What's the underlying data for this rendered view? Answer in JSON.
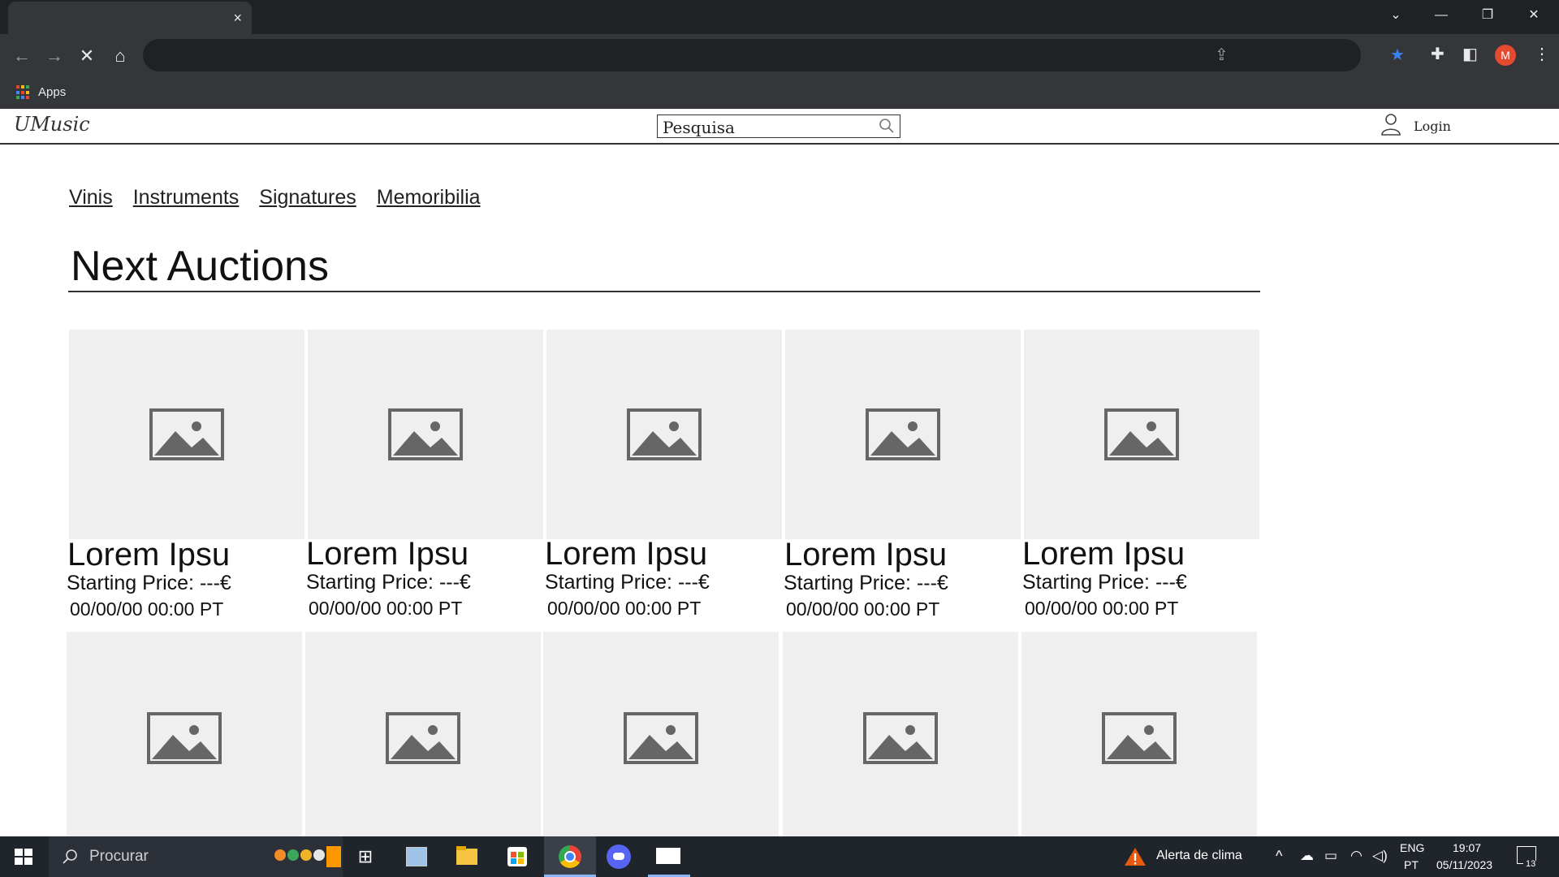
{
  "browser": {
    "tab_close": "×",
    "bookmarks": {
      "apps_label": "Apps"
    },
    "avatar_letter": "M"
  },
  "site": {
    "logo": "UMusic",
    "search_placeholder": "Pesquisa",
    "login_label": "Login",
    "categories": [
      "Vinis",
      "Instruments",
      "Signatures",
      "Memoribilia"
    ],
    "heading": "Next Auctions",
    "cards": [
      {
        "title": "Lorem Ipsu",
        "price": "Starting Price: ---€",
        "date": "00/00/00 00:00 PT"
      },
      {
        "title": "Lorem Ipsu",
        "price": "Starting Price: ---€",
        "date": "00/00/00 00:00 PT"
      },
      {
        "title": "Lorem Ipsu",
        "price": "Starting Price: ---€",
        "date": "00/00/00 00:00 PT"
      },
      {
        "title": "Lorem Ipsu",
        "price": "Starting Price: ---€",
        "date": "00/00/00 00:00 PT"
      },
      {
        "title": "Lorem Ipsu",
        "price": "Starting Price: ---€",
        "date": "00/00/00 00:00 PT"
      }
    ]
  },
  "taskbar": {
    "search_label": "Procurar",
    "weather_alert": "Alerta de clima",
    "lang_top": "ENG",
    "lang_bottom": "PT",
    "time": "19:07",
    "date": "05/11/2023",
    "notification_count": "13"
  },
  "colors": {
    "chrome_dark": "#202124",
    "chrome_toolbar": "#35363a",
    "placeholder_bg": "#efefef",
    "placeholder_icon": "#666666",
    "avatar": "#e34a2f",
    "star": "#3b82f6"
  }
}
